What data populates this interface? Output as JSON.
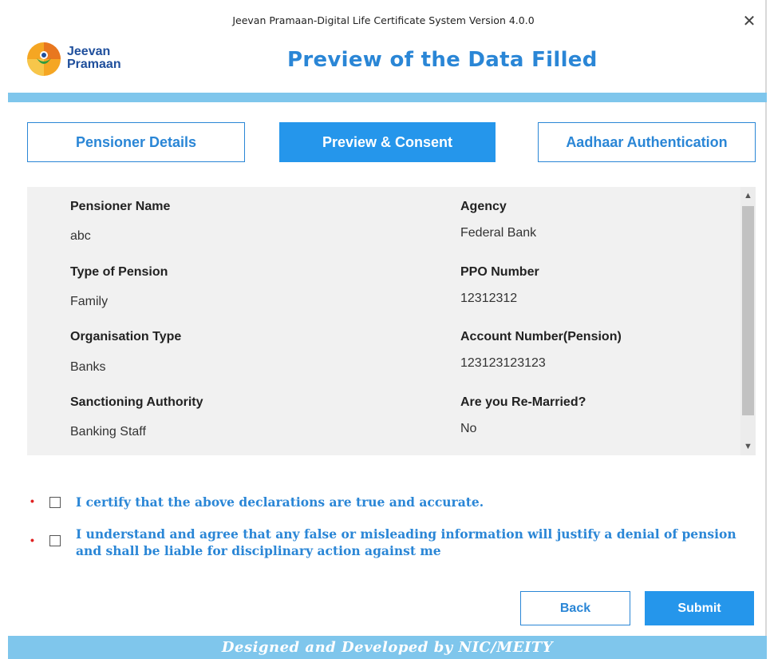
{
  "window": {
    "title": "Jeevan Pramaan-Digital Life Certificate System Version 4.0.0",
    "close_icon": "close-icon"
  },
  "header": {
    "logo_line1": "Jeevan",
    "logo_line2": "Pramaan",
    "heading": "Preview of the Data Filled"
  },
  "tabs": [
    {
      "label": "Pensioner Details",
      "active": false
    },
    {
      "label": "Preview & Consent",
      "active": true
    },
    {
      "label": "Aadhaar Authentication",
      "active": false
    }
  ],
  "details": {
    "left": [
      {
        "label": "Pensioner Name",
        "value": "abc"
      },
      {
        "label": "Type of Pension",
        "value": "Family"
      },
      {
        "label": "Organisation Type",
        "value": "Banks"
      },
      {
        "label": "Sanctioning Authority",
        "value": "Banking Staff"
      }
    ],
    "right": [
      {
        "label": "Agency",
        "value": "Federal Bank"
      },
      {
        "label": "PPO Number",
        "value": "12312312"
      },
      {
        "label": "Account Number(Pension)",
        "value": "123123123123"
      },
      {
        "label": "Are you Re-Married?",
        "value": "No"
      }
    ]
  },
  "consent": {
    "required_marker": "•",
    "item1": "I certify that the above declarations are true and accurate.",
    "item2": "I understand and agree that any false or misleading information will justify a denial of pension and shall be liable for disciplinary action against me"
  },
  "buttons": {
    "back": "Back",
    "submit": "Submit"
  },
  "footer": {
    "text": "Designed and Developed by NIC/MEITY"
  },
  "colors": {
    "accent": "#2596eb",
    "band": "#7fc6ec",
    "panel": "#f1f1f1",
    "required": "#e02020"
  }
}
